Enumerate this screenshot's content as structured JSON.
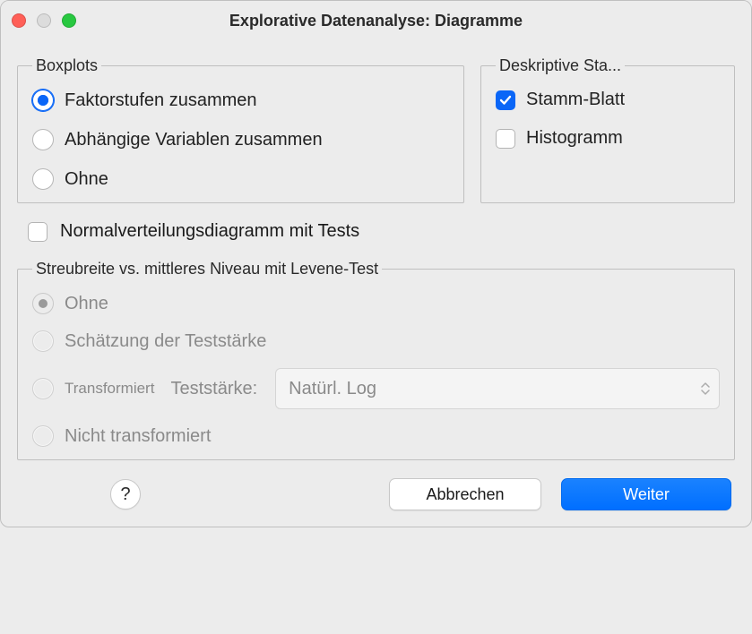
{
  "window": {
    "title": "Explorative Datenanalyse: Diagramme"
  },
  "boxplots": {
    "legend": "Boxplots",
    "options": {
      "together": "Faktorstufen zusammen",
      "depvars": "Abhängige Variablen zusammen",
      "none": "Ohne"
    }
  },
  "stats": {
    "legend": "Deskriptive Sta...",
    "stem": "Stamm-Blatt",
    "hist": "Histogramm"
  },
  "normality": {
    "label": "Normalverteilungsdiagramm mit Tests"
  },
  "levene": {
    "legend": "Streubreite vs. mittleres Niveau mit Levene-Test",
    "options": {
      "none": "Ohne",
      "power_est": "Schätzung der Teststärke",
      "transformed": "Transformiert",
      "power_label": "Teststärke:",
      "power_value": "Natürl. Log",
      "untransformed": "Nicht transformiert"
    }
  },
  "buttons": {
    "help": "?",
    "cancel": "Abbrechen",
    "continue": "Weiter"
  }
}
